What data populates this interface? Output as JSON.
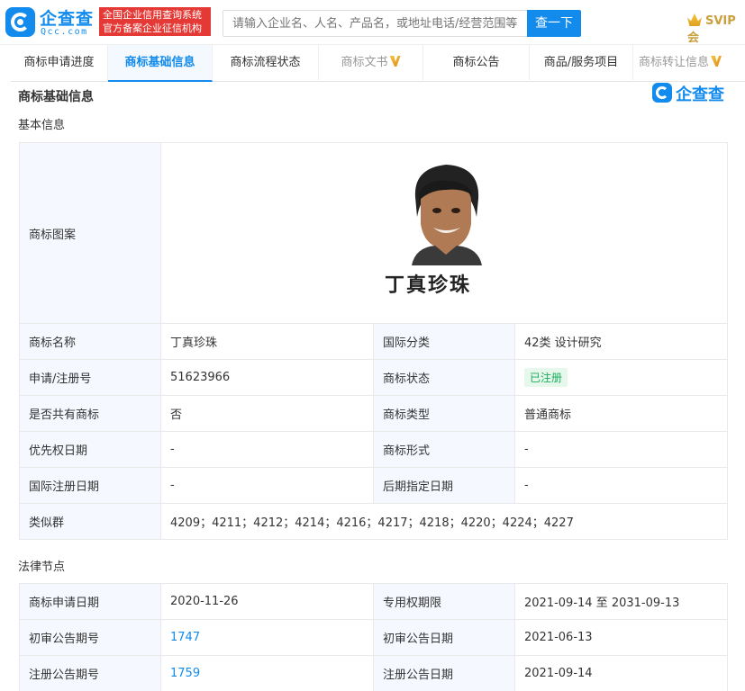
{
  "header": {
    "logo_text": "企查查",
    "logo_sub": "Qcc.com",
    "badge_line1": "全国企业信用查询系统",
    "badge_line2": "官方备案企业征信机构",
    "search_placeholder": "请输入企业名、人名、产品名，或地址电话/经营范围等",
    "search_button": "查一下",
    "vip_label": "SVIP会"
  },
  "tabs": [
    {
      "label": "商标申请进度"
    },
    {
      "label": "商标基础信息"
    },
    {
      "label": "商标流程状态"
    },
    {
      "label": "商标文书"
    },
    {
      "label": "商标公告"
    },
    {
      "label": "商品/服务项目"
    },
    {
      "label": "商标转让信息"
    }
  ],
  "page_title": "商标基础信息",
  "watermark_text": "企查查",
  "basic": {
    "section_title": "基本信息",
    "image_label": "商标图案",
    "trademark_text": "丁真珍珠",
    "rows": [
      {
        "k1": "商标名称",
        "v1": "丁真珍珠",
        "k2": "国际分类",
        "v2": "42类 设计研究"
      },
      {
        "k1": "申请/注册号",
        "v1": "51623966",
        "k2": "商标状态",
        "v2": "已注册"
      },
      {
        "k1": "是否共有商标",
        "v1": "否",
        "k2": "商标类型",
        "v2": "普通商标"
      },
      {
        "k1": "优先权日期",
        "v1": "-",
        "k2": "商标形式",
        "v2": "-"
      },
      {
        "k1": "国际注册日期",
        "v1": "-",
        "k2": "后期指定日期",
        "v2": "-"
      }
    ],
    "similar_label": "类似群",
    "similar_value": "4209；4211；4212；4214；4216；4217；4218；4220；4224；4227"
  },
  "legal": {
    "section_title": "法律节点",
    "rows": [
      {
        "k1": "商标申请日期",
        "v1": "2020-11-26",
        "k2": "专用权期限",
        "v2": "2021-09-14 至 2031-09-13"
      },
      {
        "k1": "初审公告期号",
        "v1": "1747",
        "k2": "初审公告日期",
        "v2": "2021-06-13"
      },
      {
        "k1": "注册公告期号",
        "v1": "1759",
        "k2": "注册公告日期",
        "v2": "2021-09-14"
      }
    ]
  },
  "colors": {
    "brand": "#128bed",
    "badge_red": "#e53935",
    "status_green": "#1aad5b"
  }
}
